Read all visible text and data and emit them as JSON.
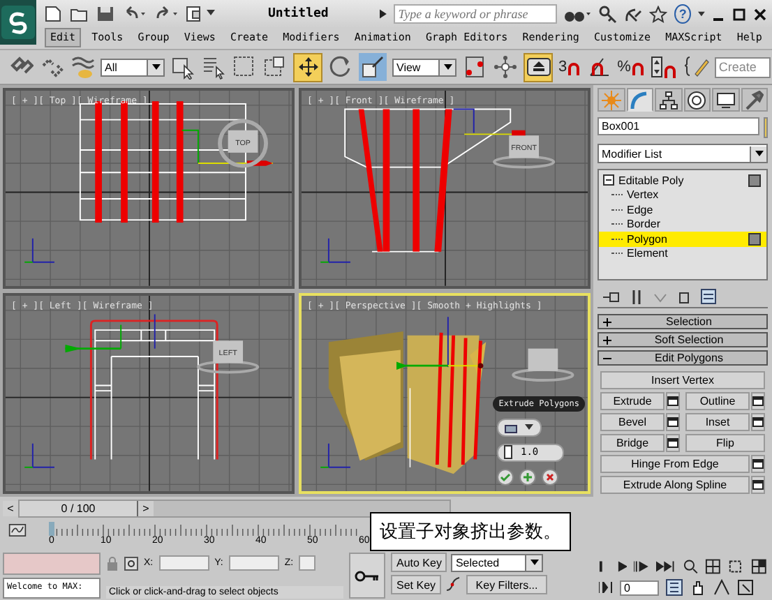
{
  "title_bar": {
    "title": "Untitled",
    "search": {
      "placeholder": "Type a keyword or phrase"
    },
    "help": "?"
  },
  "menu": [
    {
      "label": "Edit",
      "selected": true
    },
    {
      "label": "Tools",
      "selected": false
    },
    {
      "label": "Group",
      "selected": false
    },
    {
      "label": "Views",
      "selected": false
    },
    {
      "label": "Create",
      "selected": false
    },
    {
      "label": "Modifiers",
      "selected": false
    },
    {
      "label": "Animation",
      "selected": false
    },
    {
      "label": "Graph Editors",
      "selected": false
    },
    {
      "label": "Rendering",
      "selected": false
    },
    {
      "label": "Customize",
      "selected": false
    },
    {
      "label": "MAXScript",
      "selected": false
    },
    {
      "label": "Help",
      "selected": false
    }
  ],
  "toolbar": {
    "selection_filter": "All",
    "reference_coordinates": "View",
    "named_selection": {
      "placeholder": "Create"
    },
    "move_tool": {
      "on": true
    },
    "snap_toggle": {
      "on": true
    },
    "snap_label": "3",
    "percent_label": "%"
  },
  "viewports": [
    {
      "label": "[ + ][ Top ][ Wireframe ]",
      "kind": "top",
      "cube_label": "TOP",
      "selected": false
    },
    {
      "label": "[ + ][ Front ][ Wireframe ]",
      "kind": "front",
      "cube_label": "FRONT",
      "selected": false
    },
    {
      "label": "[ + ][ Left ][ Wireframe ]",
      "kind": "left",
      "cube_label": "LEFT",
      "selected": false
    },
    {
      "label": "[ + ][ Perspective ][ Smooth + Highlights ]",
      "kind": "perspective",
      "selected": true,
      "caddy": {
        "title": "Extrude Polygons",
        "value": "1.0"
      }
    }
  ],
  "time_slider": {
    "frame": "0 / 100",
    "prev": "<",
    "next": ">"
  },
  "ruler": {
    "labels": [
      "0",
      "10",
      "20",
      "30",
      "40",
      "50",
      "60"
    ]
  },
  "callout": "设置子对象挤出参数。",
  "status": {
    "listener_text": "Welcome to MAX:",
    "x_label": "X:",
    "y_label": "Y:",
    "z_label": "Z:",
    "prompt": "Click or click-and-drag to select objects",
    "auto_key": {
      "label": "Auto Key",
      "on": false
    },
    "set_key": "Set Key",
    "key_mode": "Selected",
    "key_filters": "Key Filters...",
    "current_frame": "0"
  },
  "command_panel": {
    "tabs": [
      {
        "selected": false
      },
      {
        "selected": true
      },
      {
        "selected": false
      },
      {
        "selected": false
      },
      {
        "selected": false
      },
      {
        "selected": false
      }
    ],
    "object_name": "Box001",
    "modifier_list": "Modifier List",
    "stack": [
      {
        "label": "Editable Poly",
        "expanded": true,
        "selected": false,
        "children": [
          {
            "label": "Vertex",
            "selected": false
          },
          {
            "label": "Edge",
            "selected": false
          },
          {
            "label": "Border",
            "selected": false
          },
          {
            "label": "Polygon",
            "selected": true
          },
          {
            "label": "Element",
            "selected": false
          }
        ]
      }
    ],
    "rollouts": [
      {
        "title": "Selection",
        "expanded": false
      },
      {
        "title": "Soft Selection",
        "expanded": false
      },
      {
        "title": "Edit Polygons",
        "expanded": true,
        "button_rows": [
          [
            {
              "label": "Insert Vertex",
              "settings": false
            }
          ],
          [
            {
              "label": "Extrude",
              "settings": true
            },
            {
              "label": "Outline",
              "settings": true
            }
          ],
          [
            {
              "label": "Bevel",
              "settings": true
            },
            {
              "label": "Inset",
              "settings": true
            }
          ],
          [
            {
              "label": "Bridge",
              "settings": true
            },
            {
              "label": "Flip",
              "settings": false
            }
          ],
          [
            {
              "label": "Hinge From Edge",
              "settings": true
            }
          ],
          [
            {
              "label": "Extrude Along Spline",
              "settings": true
            }
          ]
        ]
      }
    ]
  }
}
